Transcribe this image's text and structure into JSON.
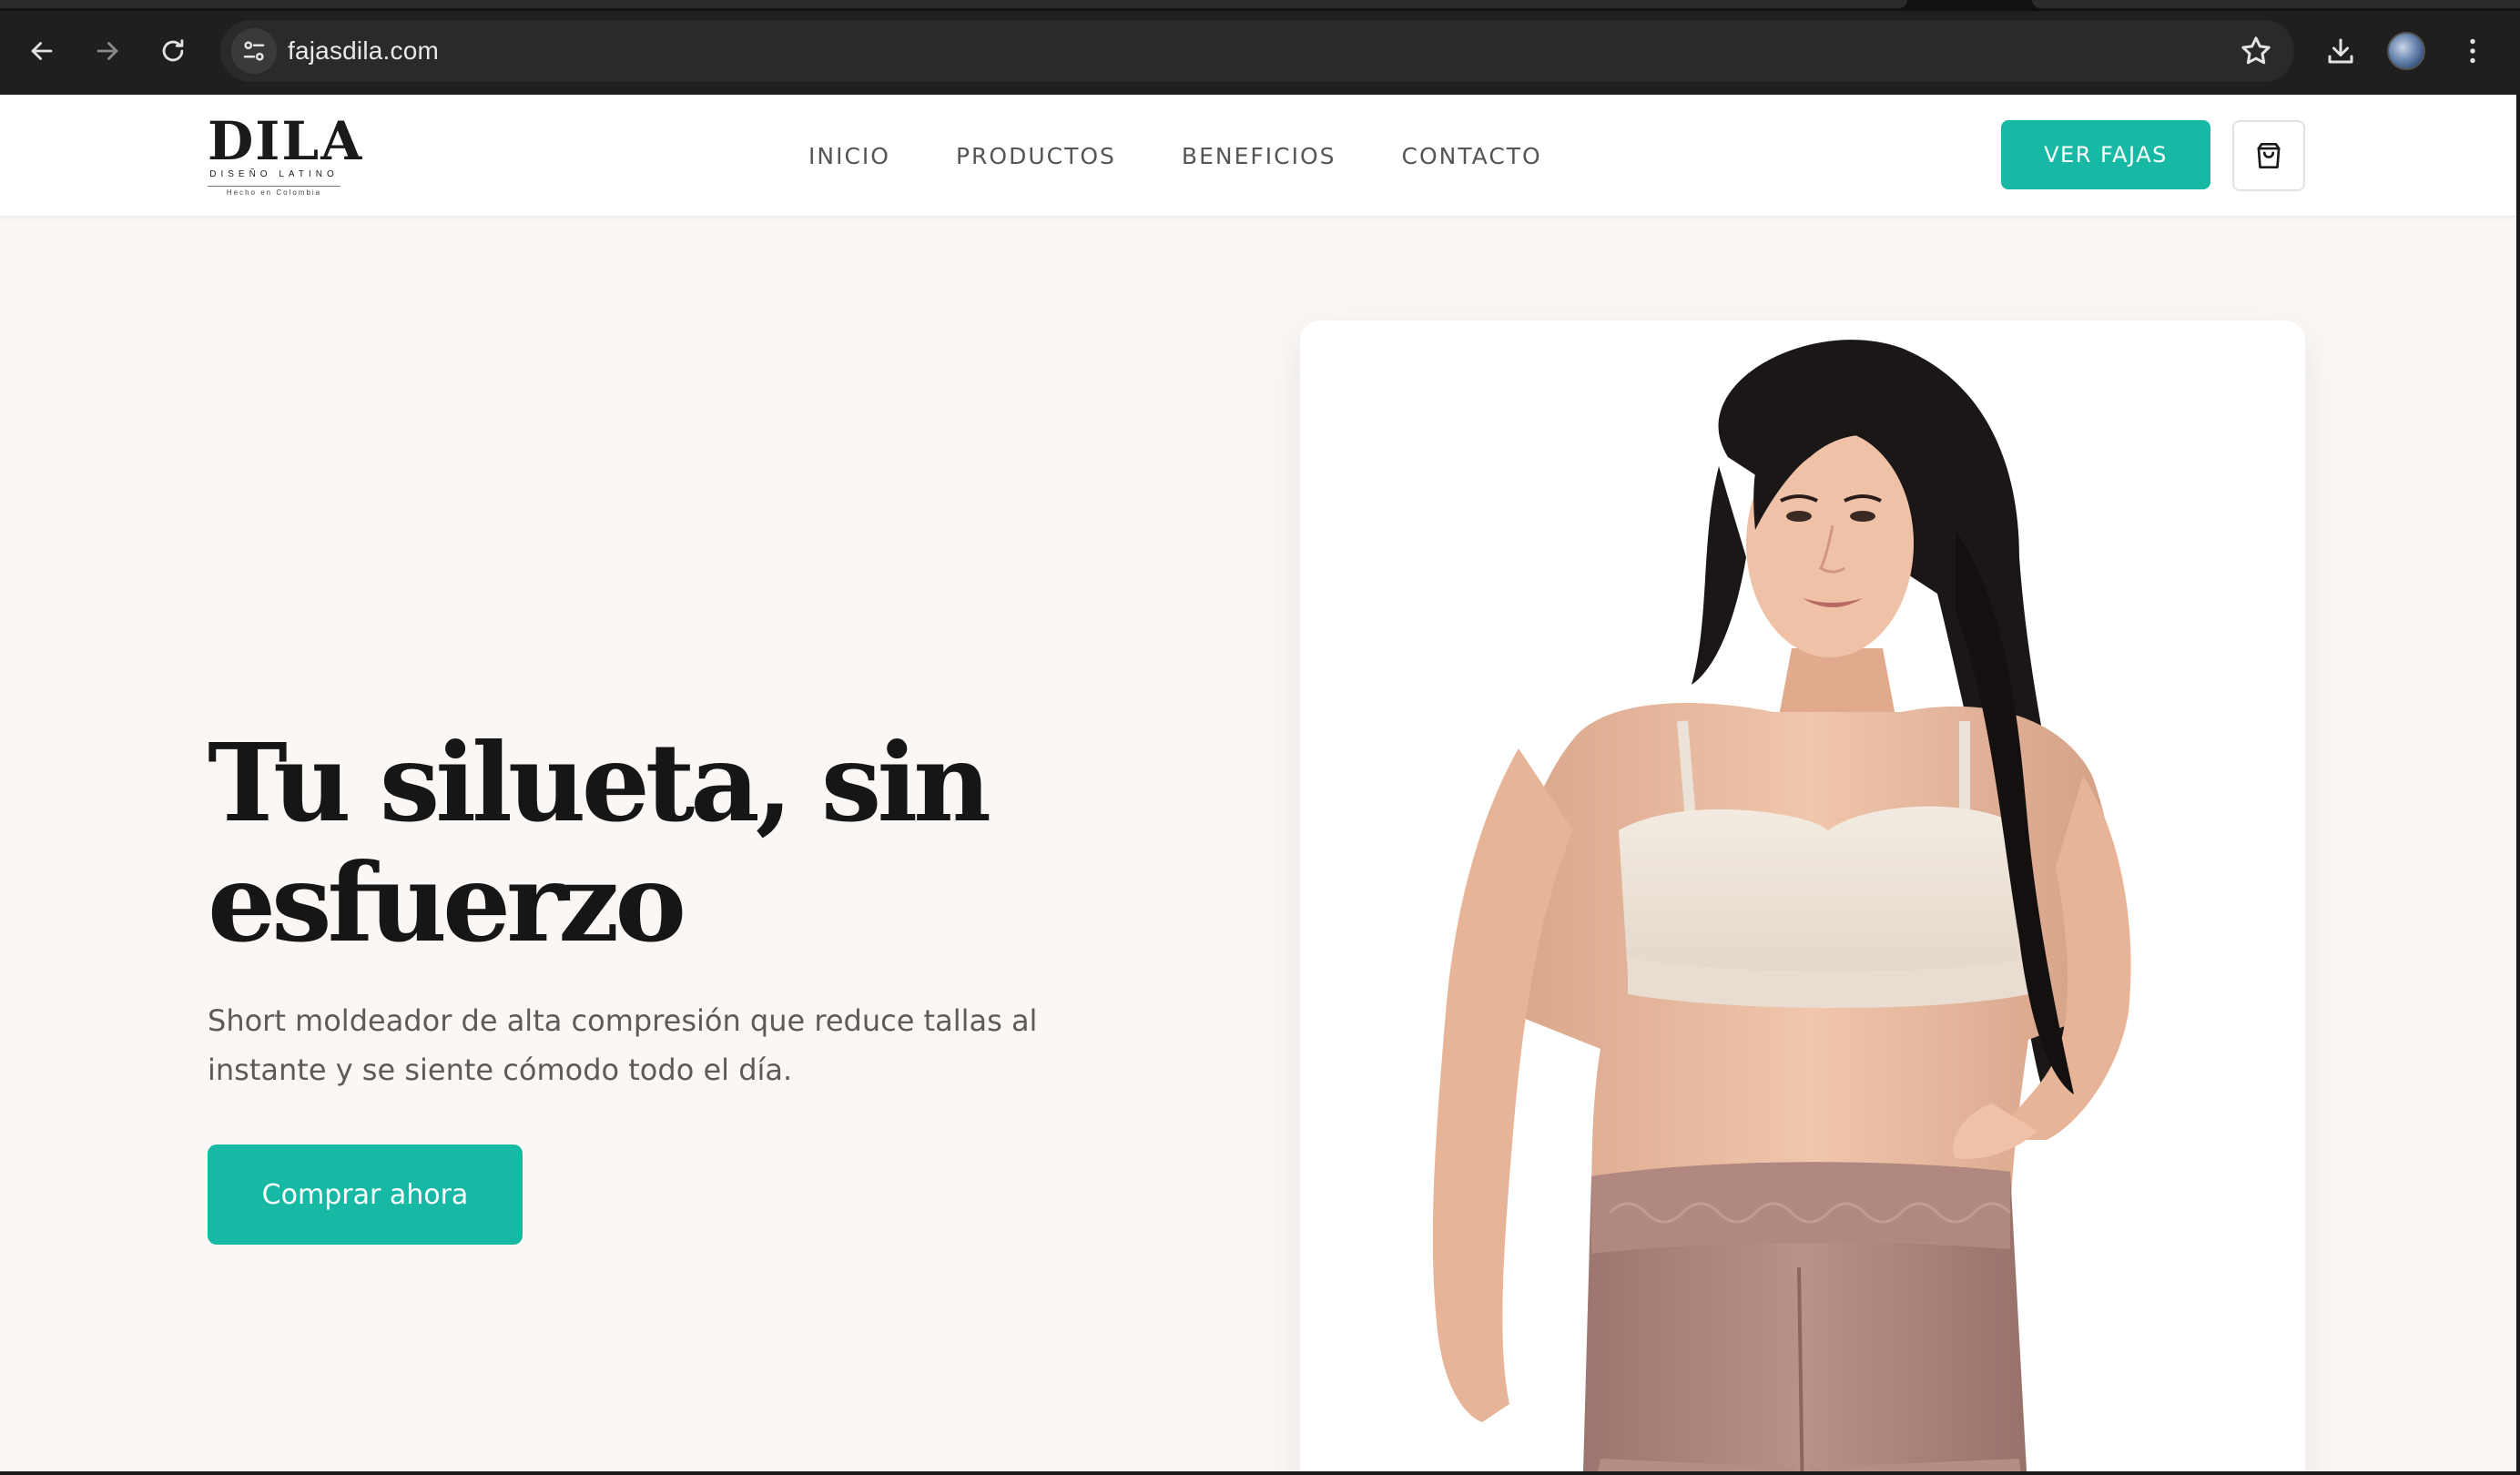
{
  "browser": {
    "url": "fajasdila.com",
    "icons": {
      "back": "arrow-left-icon",
      "forward": "arrow-right-icon",
      "reload": "reload-icon",
      "site_info": "tune-icon",
      "bookmark": "star-icon",
      "downloads": "download-icon",
      "menu": "kebab-menu-icon"
    }
  },
  "header": {
    "logo": {
      "wordmark": "DILA",
      "subtitle": "DISEÑO LATINO",
      "tagline": "Hecho en Colombia"
    },
    "nav": [
      "INICIO",
      "PRODUCTOS",
      "BENEFICIOS",
      "CONTACTO"
    ],
    "cta_label": "VER FAJAS",
    "cart_icon": "shopping-bag-icon"
  },
  "hero": {
    "title_line1": "Tu silueta, sin",
    "title_line2": "esfuerzo",
    "subtitle_line1": "Short moldeador de alta compresión que reduce tallas al",
    "subtitle_line2": "instante y se siente cómodo todo el día.",
    "cta_label": "Comprar ahora"
  },
  "colors": {
    "accent": "#17b9a4",
    "page_background": "#faf7f5",
    "title_text": "#161616",
    "body_text": "#5d5a57"
  }
}
